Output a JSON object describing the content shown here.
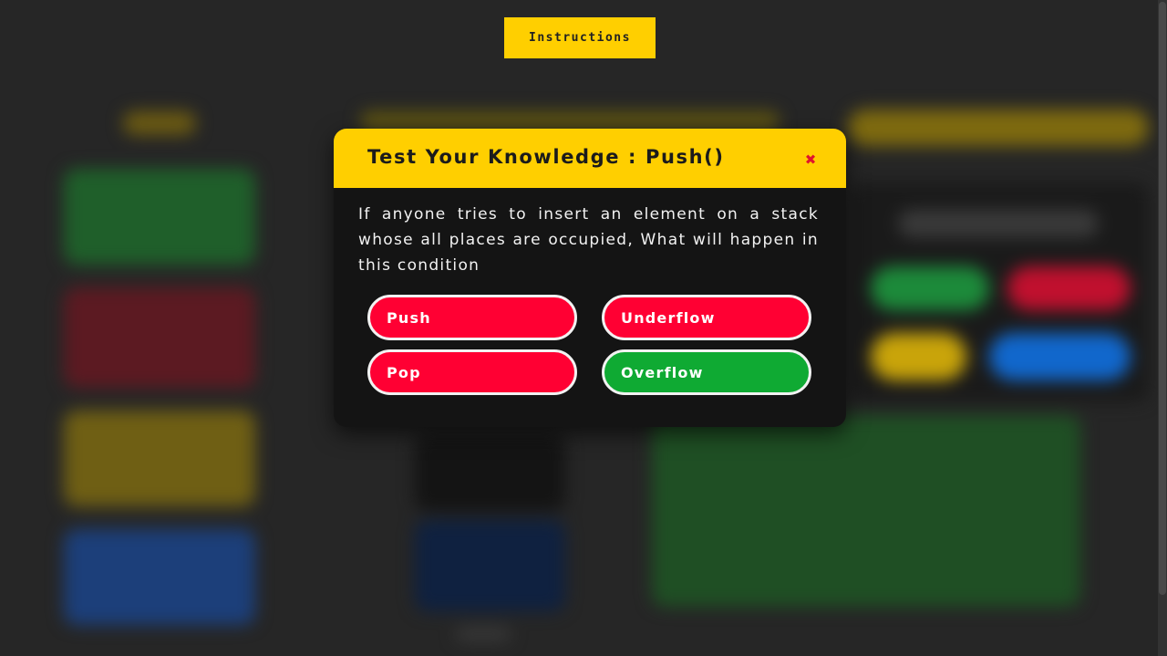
{
  "header": {
    "instructions_label": "Instructions"
  },
  "modal": {
    "title": "Test Your Knowledge : Push()",
    "close_icon": "close-icon",
    "question": "If anyone tries to insert an element on a stack whose all places are occupied, What will happen in this condition",
    "options": [
      {
        "label": "Push",
        "state": "incorrect",
        "color": "#ff0033"
      },
      {
        "label": "Underflow",
        "state": "incorrect",
        "color": "#ff0033"
      },
      {
        "label": "Pop",
        "state": "incorrect",
        "color": "#ff0033"
      },
      {
        "label": "Overflow",
        "state": "correct",
        "color": "#0faa33"
      }
    ]
  },
  "colors": {
    "accent": "#ffcf00",
    "background": "#262626",
    "modal_background": "#141414",
    "incorrect": "#ff0033",
    "correct": "#0faa33",
    "close": "#e0142d"
  }
}
